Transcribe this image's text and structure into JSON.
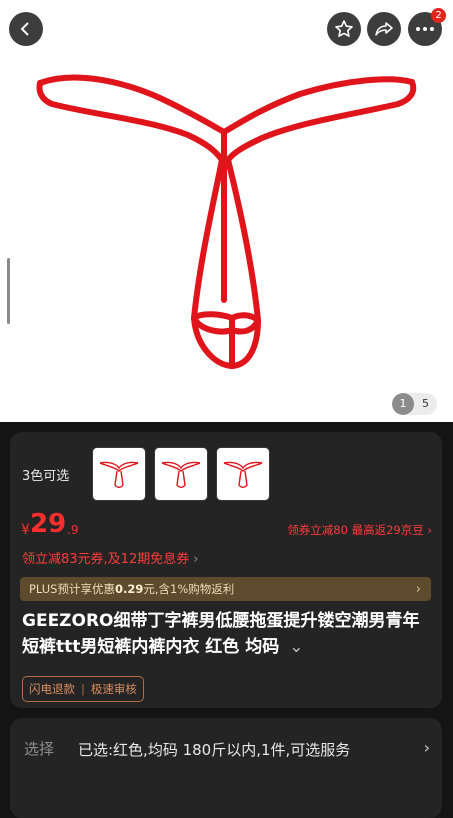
{
  "header": {
    "back_icon": "chevron-left-icon",
    "favorite_icon": "star-icon",
    "share_icon": "share-arrow-icon",
    "more_icon": "more-dots-icon",
    "message_badge": "2"
  },
  "gallery": {
    "current": "1",
    "total": "5",
    "product_color": "#e0141b"
  },
  "options": {
    "color_count_label": "3色可选"
  },
  "price": {
    "symbol": "¥",
    "integer": "29",
    "decimal": ".9",
    "promo_right": "领券立减80  最高返29京豆 ›",
    "coupon_line": "领立减83元券,及12期免息券",
    "coupon_chevron": "›"
  },
  "plus": {
    "prefix": "PLUS预计享优惠",
    "amount": "0.29",
    "suffix": "元,含1%购物返利",
    "chevron": "›"
  },
  "product": {
    "title": "GEEZORO细带丁字裤男低腰拖蛋提升镂空潮男青年短裤ttt男短裤内裤内衣 红色 均码",
    "title_chevron": "⌄"
  },
  "tags": [
    "闪电退款",
    "极速审核"
  ],
  "selection": {
    "label": "选择",
    "value": "已选:红色,均码  180斤以内,1件,可选服务",
    "chevron": "›"
  },
  "colors": {
    "accent_red": "#ff2e2e",
    "plus_bg": "#5e4a2c",
    "card_bg": "#242424"
  }
}
